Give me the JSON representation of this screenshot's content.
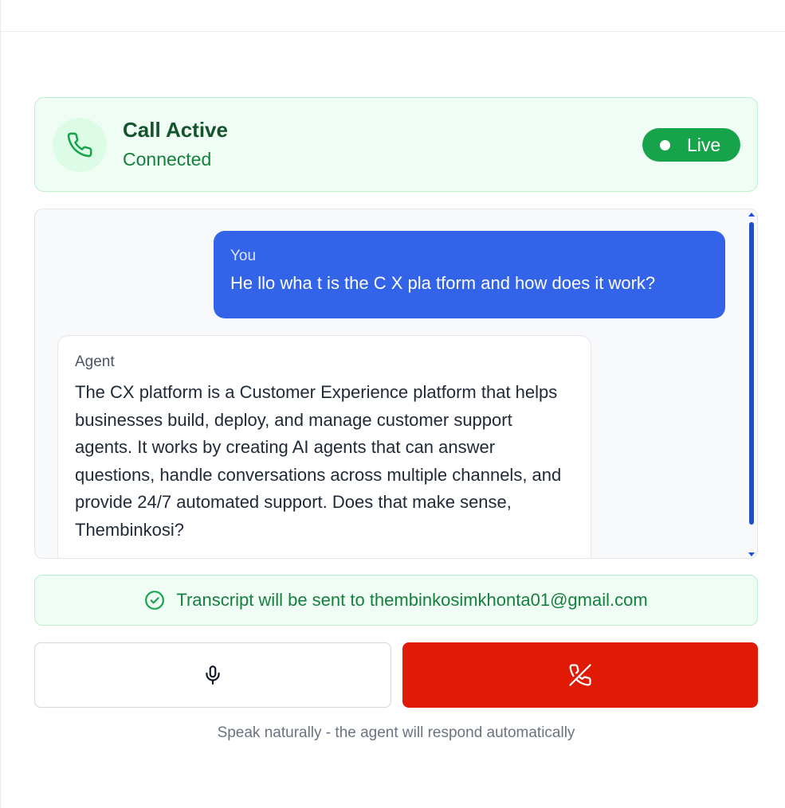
{
  "call": {
    "title": "Call Active",
    "status": "Connected",
    "badge": "Live",
    "icon": "phone-icon"
  },
  "transcript": {
    "messages": [
      {
        "role": "You",
        "text": "He llo wha t is the C X pla tform and how does it work?"
      },
      {
        "role": "Agent",
        "text": "The CX platform is a Customer Experience platform that helps businesses build, deploy, and manage customer support agents. It works by creating AI agents that can answer questions, handle conversations across multiple channels, and provide 24/7 automated support. Does that make sense, Thembinkosi?"
      }
    ]
  },
  "email_notice": {
    "text": "Transcript will be sent to thembinkosimkhonta01@gmail.com",
    "icon": "check-circle-icon"
  },
  "controls": {
    "mic_icon": "microphone-icon",
    "end_icon": "phone-off-icon"
  },
  "hint": "Speak naturally - the agent will respond automatically",
  "colors": {
    "accent_green": "#16a34a",
    "user_bubble": "#3263e9",
    "end_call": "#e11a06"
  }
}
